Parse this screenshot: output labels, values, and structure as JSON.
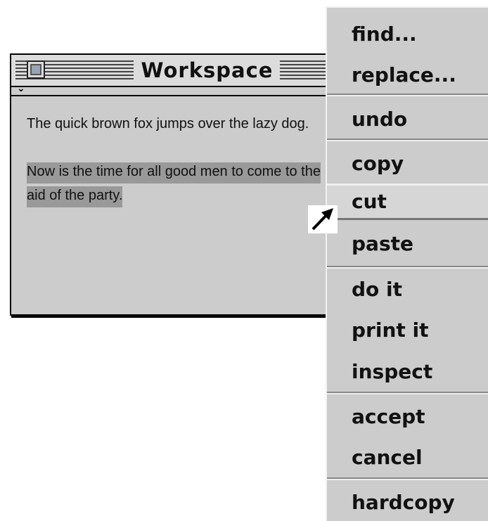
{
  "window": {
    "title": "Workspace",
    "pane_chevron": "⌄",
    "text": {
      "paragraph_1": "The quick brown fox jumps over the lazy dog.",
      "paragraph_2_selected": "Now is the time for all good men to come to the aid of the party."
    }
  },
  "menu": {
    "items": [
      {
        "label": "find..."
      },
      {
        "label": "replace..."
      },
      {
        "label": "undo"
      },
      {
        "label": "copy"
      },
      {
        "label": "cut"
      },
      {
        "label": "paste"
      },
      {
        "label": "do it"
      },
      {
        "label": "print it"
      },
      {
        "label": "inspect"
      },
      {
        "label": "accept"
      },
      {
        "label": "cancel"
      },
      {
        "label": "hardcopy"
      }
    ],
    "highlighted_item": "cut"
  },
  "cursor": {
    "icon": "arrow-cursor-icon"
  },
  "colors": {
    "window_background": "#cccccc",
    "selection_highlight": "#999999",
    "menu_background": "#cccccc",
    "frame": "#000000"
  }
}
